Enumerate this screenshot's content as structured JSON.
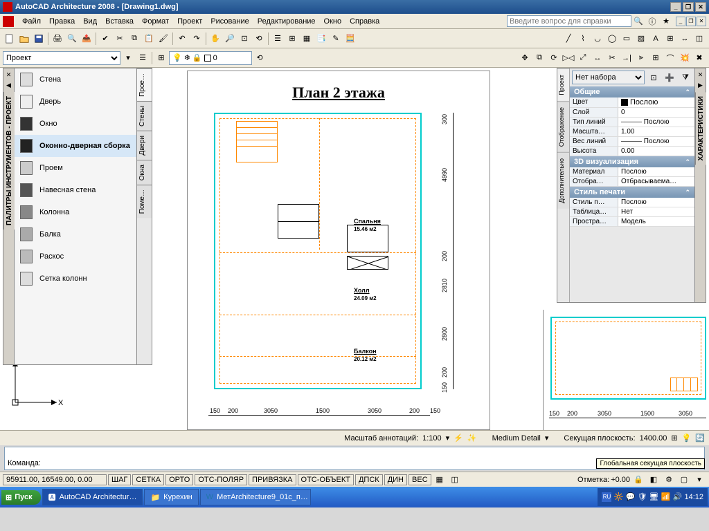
{
  "title": "AutoCAD Architecture 2008 - [Drawing1.dwg]",
  "menubar": [
    "Файл",
    "Правка",
    "Вид",
    "Вставка",
    "Формат",
    "Проект",
    "Рисование",
    "Редактирование",
    "Окно",
    "Справка"
  ],
  "search_placeholder": "Введите вопрос для справки",
  "layer_combo": "Проект",
  "layer_current": "0",
  "palette": {
    "title": "ПАЛИТРЫ ИНСТРУМЕНТОВ - ПРОЕКТ",
    "items": [
      "Стена",
      "Дверь",
      "Окно",
      "Оконно-дверная сборка",
      "Проем",
      "Навесная стена",
      "Колонна",
      "Балка",
      "Раскос",
      "Сетка колонн"
    ],
    "tabs": [
      "Прое…",
      "Стены",
      "Двери",
      "Окна",
      "Поме…"
    ]
  },
  "sheet": {
    "title": "План 2 этажа",
    "rooms": [
      {
        "name": "Спальня",
        "area": "15.46 м2"
      },
      {
        "name": "Холл",
        "area": "24.09 м2"
      },
      {
        "name": "Балкон",
        "area": "20.12 м2"
      }
    ],
    "dims_h": [
      "150",
      "200",
      "3050",
      "1500",
      "3050",
      "200",
      "150"
    ],
    "dims_v": [
      "300",
      "4990",
      "200",
      "2810",
      "2800",
      "200",
      "150"
    ]
  },
  "mini_dims_h": [
    "150",
    "200",
    "3050",
    "1500",
    "3050"
  ],
  "properties": {
    "title": "ХАРАКТЕРИСТИКИ",
    "selection": "Нет набора",
    "vtabs": [
      "Проект",
      "Отображение",
      "Дополнительно"
    ],
    "groups": [
      {
        "name": "Общие",
        "rows": [
          {
            "k": "Цвет",
            "v": "Послою",
            "swatch": true
          },
          {
            "k": "Слой",
            "v": "0"
          },
          {
            "k": "Тип линий",
            "v": "——— Послою"
          },
          {
            "k": "Масшта…",
            "v": "1.00"
          },
          {
            "k": "Вес линий",
            "v": "——— Послою"
          },
          {
            "k": "Высота",
            "v": "0.00"
          }
        ]
      },
      {
        "name": "3D визуализация",
        "rows": [
          {
            "k": "Материал",
            "v": "Послою"
          },
          {
            "k": "Отобра…",
            "v": "Отбрасываема…"
          }
        ]
      },
      {
        "name": "Стиль печати",
        "rows": [
          {
            "k": "Стиль п…",
            "v": "Послою"
          },
          {
            "k": "Таблица…",
            "v": "Нет"
          },
          {
            "k": "Простра…",
            "v": "Модель"
          }
        ]
      }
    ]
  },
  "status1": {
    "anno_label": "Масштаб аннотаций:",
    "anno_scale": "1:100",
    "detail": "Medium Detail",
    "cut_label": "Секущая плоскость:",
    "cut_val": "1400.00"
  },
  "tooltip": "Глобальная секущая плоскость",
  "cmd_prompt": "Команда:",
  "status2": {
    "coords": "95911.00, 16549.00, 0.00",
    "toggles": [
      "ШАГ",
      "СЕТКА",
      "ОРТО",
      "ОТС-ПОЛЯР",
      "ПРИВЯЗКА",
      "ОТС-ОБЪЕКТ",
      "ДПСК",
      "ДИН",
      "ВЕС"
    ],
    "mark_label": "Отметка:",
    "mark_val": "+0.00"
  },
  "taskbar": {
    "start": "Пуск",
    "items": [
      "AutoCAD Architectur…",
      "Курехин",
      "МетArchitecture9_01c_п…"
    ],
    "lang": "RU",
    "clock": "14:12"
  }
}
